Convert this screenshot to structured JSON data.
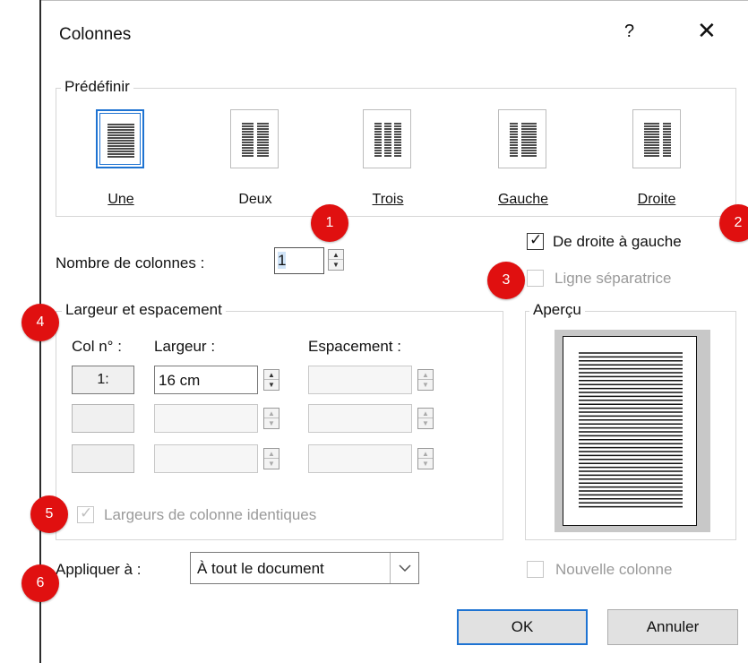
{
  "dialog": {
    "title": "Colonnes",
    "help_label": "?",
    "close_label": "✕"
  },
  "presets": {
    "legend": "Prédéfinir",
    "items": [
      {
        "label": "Une",
        "icon": "one-column-icon",
        "selected": true
      },
      {
        "label": "Deux",
        "icon": "two-columns-icon",
        "selected": false
      },
      {
        "label": "Trois",
        "icon": "three-columns-icon",
        "selected": false
      },
      {
        "label": "Gauche",
        "icon": "left-column-icon",
        "selected": false
      },
      {
        "label": "Droite",
        "icon": "right-column-icon",
        "selected": false
      }
    ]
  },
  "column_count": {
    "label": "Nombre de colonnes :",
    "value": "1"
  },
  "rtl": {
    "label": "De droite à gauche",
    "checked": true
  },
  "separator": {
    "label": "Ligne séparatrice",
    "checked": false,
    "enabled": false
  },
  "width_spacing": {
    "legend": "Largeur et espacement",
    "col_header": "Col n° :",
    "width_header": "Largeur :",
    "spacing_header": "Espacement :",
    "rows": [
      {
        "col": "1:",
        "width": "16 cm",
        "spacing": ""
      },
      {
        "col": "",
        "width": "",
        "spacing": ""
      },
      {
        "col": "",
        "width": "",
        "spacing": ""
      }
    ]
  },
  "equal_widths": {
    "label": "Largeurs de colonne identiques",
    "checked": true,
    "enabled": false
  },
  "preview": {
    "legend": "Aperçu"
  },
  "apply_to": {
    "label": "Appliquer à :",
    "value": "À tout le document"
  },
  "new_column": {
    "label": "Nouvelle colonne",
    "checked": false,
    "enabled": false
  },
  "buttons": {
    "ok": "OK",
    "cancel": "Annuler"
  },
  "badges": [
    "1",
    "2",
    "3",
    "4",
    "5",
    "6"
  ],
  "colors": {
    "accent": "#1e73d2",
    "badge": "#e01010",
    "disabled_text": "#9a9a9a"
  }
}
